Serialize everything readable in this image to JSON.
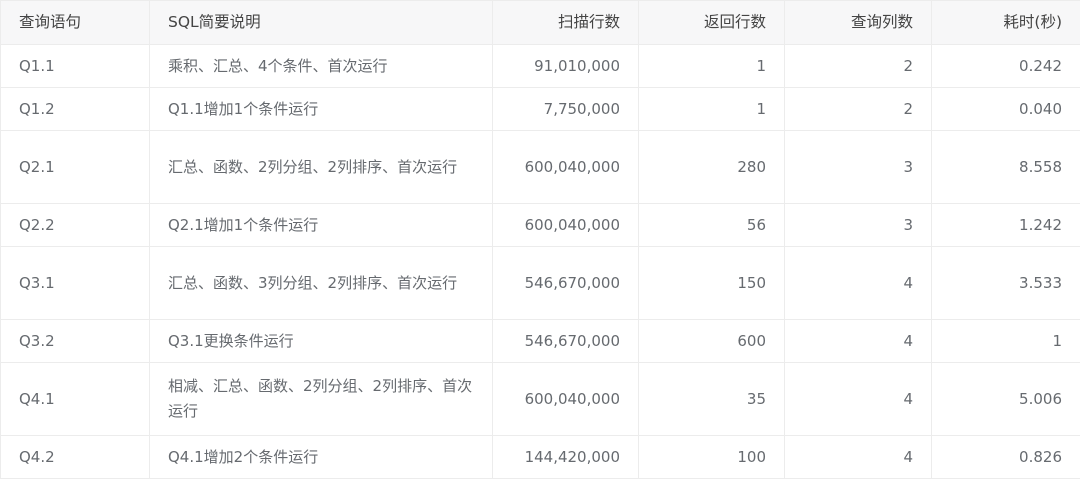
{
  "table": {
    "headers": [
      "查询语句",
      "SQL简要说明",
      "扫描行数",
      "返回行数",
      "查询列数",
      "耗时(秒)"
    ],
    "rows": [
      {
        "query": "Q1.1",
        "desc": "乘积、汇总、4个条件、首次运行",
        "scanned": "91,010,000",
        "returned": "1",
        "columns": "2",
        "time": "0.242"
      },
      {
        "query": "Q1.2",
        "desc": "Q1.1增加1个条件运行",
        "scanned": "7,750,000",
        "returned": "1",
        "columns": "2",
        "time": "0.040"
      },
      {
        "query": "Q2.1",
        "desc": "汇总、函数、2列分组、2列排序、首次运行",
        "scanned": "600,040,000",
        "returned": "280",
        "columns": "3",
        "time": "8.558"
      },
      {
        "query": "Q2.2",
        "desc": "Q2.1增加1个条件运行",
        "scanned": "600,040,000",
        "returned": "56",
        "columns": "3",
        "time": "1.242"
      },
      {
        "query": "Q3.1",
        "desc": "汇总、函数、3列分组、2列排序、首次运行",
        "scanned": "546,670,000",
        "returned": "150",
        "columns": "4",
        "time": "3.533"
      },
      {
        "query": "Q3.2",
        "desc": "Q3.1更换条件运行",
        "scanned": "546,670,000",
        "returned": "600",
        "columns": "4",
        "time": "1"
      },
      {
        "query": "Q4.1",
        "desc": "相减、汇总、函数、2列分组、2列排序、首次运行",
        "scanned": "600,040,000",
        "returned": "35",
        "columns": "4",
        "time": "5.006"
      },
      {
        "query": "Q4.2",
        "desc": "Q4.1增加2个条件运行",
        "scanned": "144,420,000",
        "returned": "100",
        "columns": "4",
        "time": "0.826"
      }
    ]
  }
}
